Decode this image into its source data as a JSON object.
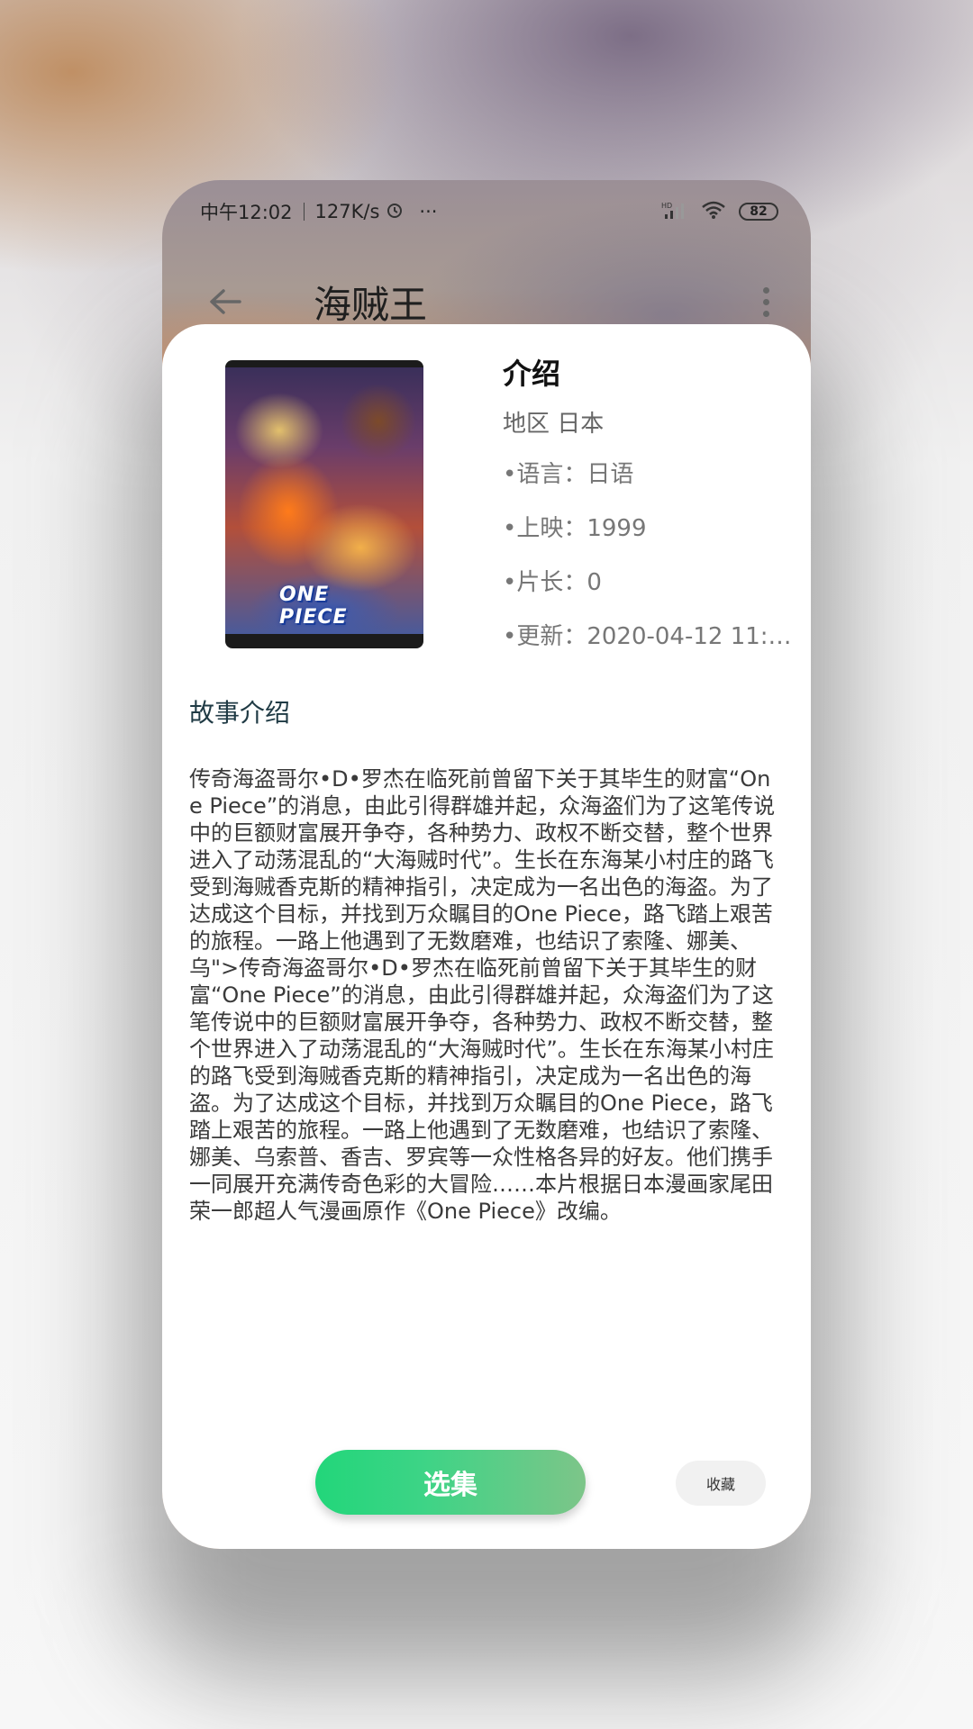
{
  "status_bar": {
    "time": "中午12:02",
    "network_speed": "127K/s",
    "more": "···",
    "signal_label": "HD",
    "battery": "82"
  },
  "app_bar": {
    "title": "海贼王",
    "back_icon": "arrow-left-icon",
    "menu_icon": "more-vertical-icon"
  },
  "poster": {
    "logo_text": "ONE PIECE"
  },
  "info": {
    "title": "介绍",
    "region": "地区 日本",
    "language": "•语言：日语",
    "release": "•上映：1999",
    "duration": "•片长：0",
    "updated": "•更新：2020-04-12 11:45:1.."
  },
  "story": {
    "title": "故事介绍",
    "text": "传奇海盗哥尔•D•罗杰在临死前曾留下关于其毕生的财富“One Piece”的消息，由此引得群雄并起，众海盗们为了这笔传说中的巨额财富展开争夺，各种势力、政权不断交替，整个世界进入了动荡混乱的“大海贼时代”。生长在东海某小村庄的路飞受到海贼香克斯的精神指引，决定成为一名出色的海盗。为了达成这个目标，并找到万众瞩目的One Piece，路飞踏上艰苦的旅程。一路上他遇到了无数磨难，也结识了索隆、娜美、乌\">传奇海盗哥尔•D•罗杰在临死前曾留下关于其毕生的财富“One Piece”的消息，由此引得群雄并起，众海盗们为了这笔传说中的巨额财富展开争夺，各种势力、政权不断交替，整个世界进入了动荡混乱的“大海贼时代”。生长在东海某小村庄的路飞受到海贼香克斯的精神指引，决定成为一名出色的海盗。为了达成这个目标，并找到万众瞩目的One Piece，路飞踏上艰苦的旅程。一路上他遇到了无数磨难，也结识了索隆、娜美、乌索普、香吉、罗宾等一众性格各异的好友。他们携手一同展开充满传奇色彩的大冒险……本片根据日本漫画家尾田荣一郎超人气漫画原作《One Piece》改编。"
  },
  "actions": {
    "select_label": "选集",
    "favorite_label": "收藏"
  },
  "colors": {
    "accent_start": "#22d67a",
    "accent_end": "#7dc589",
    "sheet_bg": "#ffffff"
  }
}
